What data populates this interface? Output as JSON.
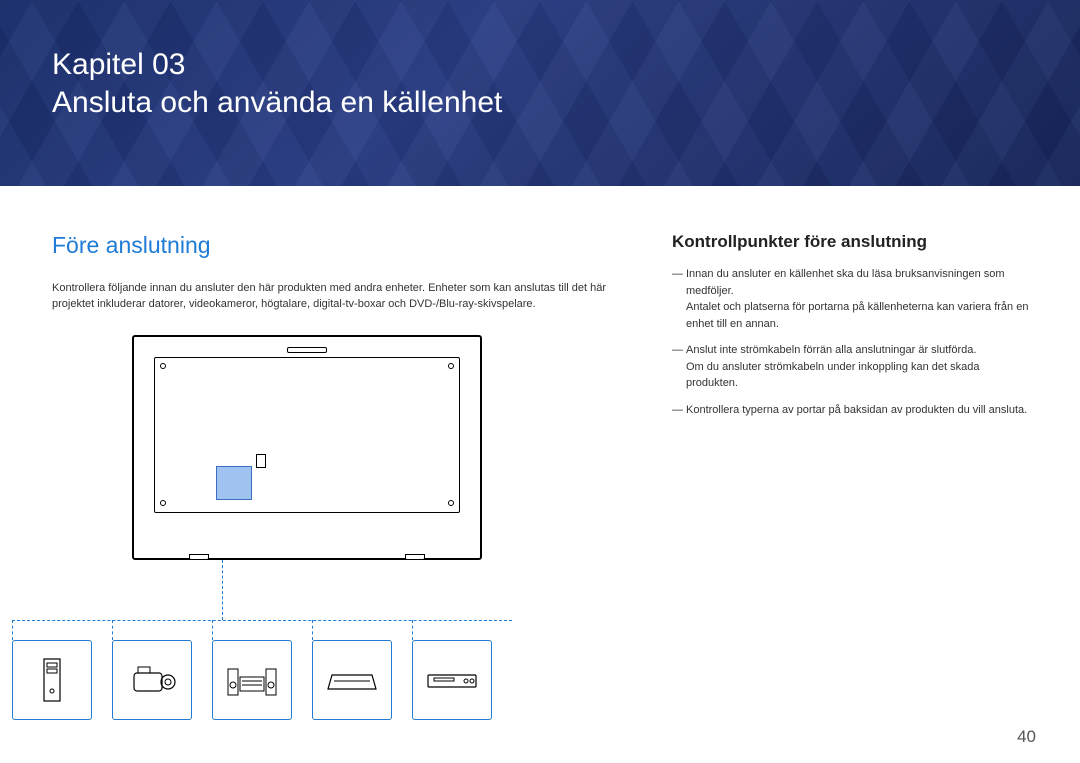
{
  "banner": {
    "chapter": "Kapitel 03",
    "title": "Ansluta och använda en källenhet"
  },
  "left": {
    "section_title": "Före anslutning",
    "intro": "Kontrollera följande innan du ansluter den här produkten med andra enheter. Enheter som kan anslutas till det här projektet inkluderar datorer, videokameror, högtalare, digital-tv-boxar och DVD-/Blu-ray-skivspelare."
  },
  "right": {
    "subhead": "Kontrollpunkter före anslutning",
    "notes": [
      {
        "main": "Innan du ansluter en källenhet ska du läsa bruksanvisningen som medföljer.",
        "sub": "Antalet och platserna för portarna på källenheterna kan variera från en enhet till en annan."
      },
      {
        "main": "Anslut inte strömkabeln förrän alla anslutningar är slutförda.",
        "sub": "Om du ansluter strömkabeln under inkoppling kan det skada produkten."
      },
      {
        "main": "Kontrollera typerna av portar på baksidan av produkten du vill ansluta.",
        "sub": ""
      }
    ]
  },
  "devices": [
    {
      "name": "pc-tower"
    },
    {
      "name": "camcorder"
    },
    {
      "name": "stereo-system"
    },
    {
      "name": "set-top-box"
    },
    {
      "name": "disc-player"
    }
  ],
  "page_number": "40"
}
